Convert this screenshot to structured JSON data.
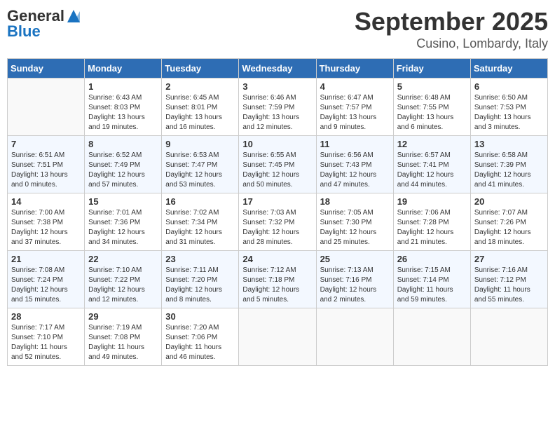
{
  "header": {
    "logo_general": "General",
    "logo_blue": "Blue",
    "month": "September 2025",
    "location": "Cusino, Lombardy, Italy"
  },
  "days_of_week": [
    "Sunday",
    "Monday",
    "Tuesday",
    "Wednesday",
    "Thursday",
    "Friday",
    "Saturday"
  ],
  "weeks": [
    [
      {
        "date": "",
        "empty": true
      },
      {
        "date": "1",
        "sunrise": "Sunrise: 6:43 AM",
        "sunset": "Sunset: 8:03 PM",
        "daylight": "Daylight: 13 hours and 19 minutes."
      },
      {
        "date": "2",
        "sunrise": "Sunrise: 6:45 AM",
        "sunset": "Sunset: 8:01 PM",
        "daylight": "Daylight: 13 hours and 16 minutes."
      },
      {
        "date": "3",
        "sunrise": "Sunrise: 6:46 AM",
        "sunset": "Sunset: 7:59 PM",
        "daylight": "Daylight: 13 hours and 12 minutes."
      },
      {
        "date": "4",
        "sunrise": "Sunrise: 6:47 AM",
        "sunset": "Sunset: 7:57 PM",
        "daylight": "Daylight: 13 hours and 9 minutes."
      },
      {
        "date": "5",
        "sunrise": "Sunrise: 6:48 AM",
        "sunset": "Sunset: 7:55 PM",
        "daylight": "Daylight: 13 hours and 6 minutes."
      },
      {
        "date": "6",
        "sunrise": "Sunrise: 6:50 AM",
        "sunset": "Sunset: 7:53 PM",
        "daylight": "Daylight: 13 hours and 3 minutes."
      }
    ],
    [
      {
        "date": "7",
        "sunrise": "Sunrise: 6:51 AM",
        "sunset": "Sunset: 7:51 PM",
        "daylight": "Daylight: 13 hours and 0 minutes."
      },
      {
        "date": "8",
        "sunrise": "Sunrise: 6:52 AM",
        "sunset": "Sunset: 7:49 PM",
        "daylight": "Daylight: 12 hours and 57 minutes."
      },
      {
        "date": "9",
        "sunrise": "Sunrise: 6:53 AM",
        "sunset": "Sunset: 7:47 PM",
        "daylight": "Daylight: 12 hours and 53 minutes."
      },
      {
        "date": "10",
        "sunrise": "Sunrise: 6:55 AM",
        "sunset": "Sunset: 7:45 PM",
        "daylight": "Daylight: 12 hours and 50 minutes."
      },
      {
        "date": "11",
        "sunrise": "Sunrise: 6:56 AM",
        "sunset": "Sunset: 7:43 PM",
        "daylight": "Daylight: 12 hours and 47 minutes."
      },
      {
        "date": "12",
        "sunrise": "Sunrise: 6:57 AM",
        "sunset": "Sunset: 7:41 PM",
        "daylight": "Daylight: 12 hours and 44 minutes."
      },
      {
        "date": "13",
        "sunrise": "Sunrise: 6:58 AM",
        "sunset": "Sunset: 7:39 PM",
        "daylight": "Daylight: 12 hours and 41 minutes."
      }
    ],
    [
      {
        "date": "14",
        "sunrise": "Sunrise: 7:00 AM",
        "sunset": "Sunset: 7:38 PM",
        "daylight": "Daylight: 12 hours and 37 minutes."
      },
      {
        "date": "15",
        "sunrise": "Sunrise: 7:01 AM",
        "sunset": "Sunset: 7:36 PM",
        "daylight": "Daylight: 12 hours and 34 minutes."
      },
      {
        "date": "16",
        "sunrise": "Sunrise: 7:02 AM",
        "sunset": "Sunset: 7:34 PM",
        "daylight": "Daylight: 12 hours and 31 minutes."
      },
      {
        "date": "17",
        "sunrise": "Sunrise: 7:03 AM",
        "sunset": "Sunset: 7:32 PM",
        "daylight": "Daylight: 12 hours and 28 minutes."
      },
      {
        "date": "18",
        "sunrise": "Sunrise: 7:05 AM",
        "sunset": "Sunset: 7:30 PM",
        "daylight": "Daylight: 12 hours and 25 minutes."
      },
      {
        "date": "19",
        "sunrise": "Sunrise: 7:06 AM",
        "sunset": "Sunset: 7:28 PM",
        "daylight": "Daylight: 12 hours and 21 minutes."
      },
      {
        "date": "20",
        "sunrise": "Sunrise: 7:07 AM",
        "sunset": "Sunset: 7:26 PM",
        "daylight": "Daylight: 12 hours and 18 minutes."
      }
    ],
    [
      {
        "date": "21",
        "sunrise": "Sunrise: 7:08 AM",
        "sunset": "Sunset: 7:24 PM",
        "daylight": "Daylight: 12 hours and 15 minutes."
      },
      {
        "date": "22",
        "sunrise": "Sunrise: 7:10 AM",
        "sunset": "Sunset: 7:22 PM",
        "daylight": "Daylight: 12 hours and 12 minutes."
      },
      {
        "date": "23",
        "sunrise": "Sunrise: 7:11 AM",
        "sunset": "Sunset: 7:20 PM",
        "daylight": "Daylight: 12 hours and 8 minutes."
      },
      {
        "date": "24",
        "sunrise": "Sunrise: 7:12 AM",
        "sunset": "Sunset: 7:18 PM",
        "daylight": "Daylight: 12 hours and 5 minutes."
      },
      {
        "date": "25",
        "sunrise": "Sunrise: 7:13 AM",
        "sunset": "Sunset: 7:16 PM",
        "daylight": "Daylight: 12 hours and 2 minutes."
      },
      {
        "date": "26",
        "sunrise": "Sunrise: 7:15 AM",
        "sunset": "Sunset: 7:14 PM",
        "daylight": "Daylight: 11 hours and 59 minutes."
      },
      {
        "date": "27",
        "sunrise": "Sunrise: 7:16 AM",
        "sunset": "Sunset: 7:12 PM",
        "daylight": "Daylight: 11 hours and 55 minutes."
      }
    ],
    [
      {
        "date": "28",
        "sunrise": "Sunrise: 7:17 AM",
        "sunset": "Sunset: 7:10 PM",
        "daylight": "Daylight: 11 hours and 52 minutes."
      },
      {
        "date": "29",
        "sunrise": "Sunrise: 7:19 AM",
        "sunset": "Sunset: 7:08 PM",
        "daylight": "Daylight: 11 hours and 49 minutes."
      },
      {
        "date": "30",
        "sunrise": "Sunrise: 7:20 AM",
        "sunset": "Sunset: 7:06 PM",
        "daylight": "Daylight: 11 hours and 46 minutes."
      },
      {
        "date": "",
        "empty": true
      },
      {
        "date": "",
        "empty": true
      },
      {
        "date": "",
        "empty": true
      },
      {
        "date": "",
        "empty": true
      }
    ]
  ]
}
